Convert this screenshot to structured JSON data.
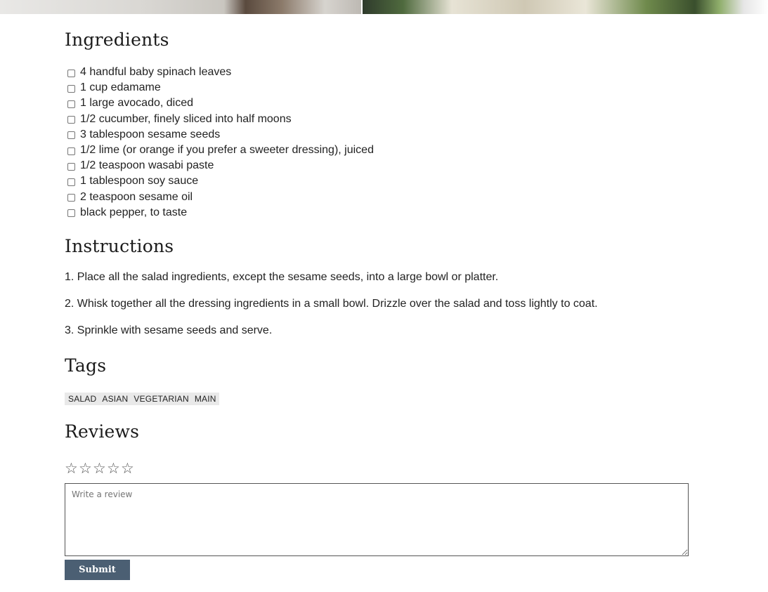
{
  "ingredients": {
    "heading": "Ingredients",
    "items": [
      "4 handful baby spinach leaves",
      "1 cup edamame",
      "1 large avocado, diced",
      "1/2 cucumber, finely sliced into half moons",
      "3 tablespoon sesame seeds",
      "1/2 lime (or orange if you prefer a sweeter dressing), juiced",
      "1/2 teaspoon wasabi paste",
      "1 tablespoon soy sauce",
      "2 teaspoon sesame oil",
      "black pepper, to taste"
    ]
  },
  "instructions": {
    "heading": "Instructions",
    "steps": [
      "1. Place all the salad ingredients, except the sesame seeds, into a large bowl or platter.",
      "2. Whisk together all the dressing ingredients in a small bowl. Drizzle over the salad and toss lightly to coat.",
      "3. Sprinkle with sesame seeds and serve."
    ]
  },
  "tags": {
    "heading": "Tags",
    "items": [
      "SALAD",
      "ASIAN",
      "VEGETARIAN",
      "MAIN"
    ]
  },
  "reviews": {
    "heading": "Reviews",
    "rating": 0,
    "max_rating": 5,
    "star_glyph": "☆",
    "review_placeholder": "Write a review",
    "submit_label": "Submit"
  },
  "colors": {
    "button_bg": "#4b5f73",
    "tag_bg": "#e9e9e9"
  }
}
